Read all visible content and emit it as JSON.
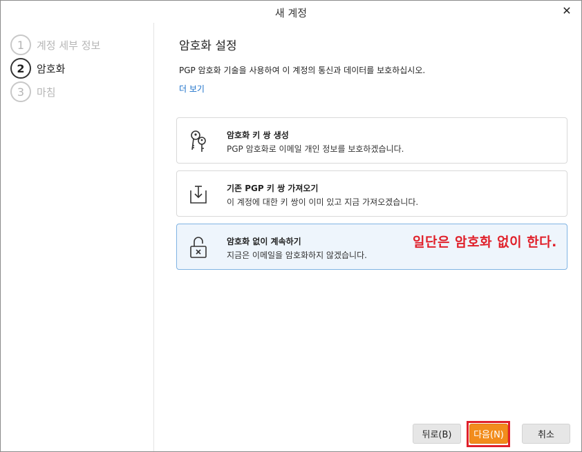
{
  "window": {
    "title": "새 계정",
    "close_icon": "close-icon"
  },
  "steps": [
    {
      "number": "1",
      "label": "계정 세부 정보"
    },
    {
      "number": "2",
      "label": "암호화"
    },
    {
      "number": "3",
      "label": "마침"
    }
  ],
  "content": {
    "heading": "암호화 설정",
    "description": "PGP 암호화 기술을 사용하여 이 계정의 통신과 데이터를 보호하십시오.",
    "more_link": "더 보기"
  },
  "options": [
    {
      "title": "암호화 키 쌍 생성",
      "description": "PGP 암호화로 이메일 개인 정보를 보호하겠습니다.",
      "icon": "keys-icon"
    },
    {
      "title": "기존 PGP 키 쌍 가져오기",
      "description": "이 계정에 대한 키 쌍이 이미 있고 지금 가져오겠습니다.",
      "icon": "import-icon"
    },
    {
      "title": "암호화 없이 계속하기",
      "description": "지금은 이메일을 암호화하지 않겠습니다.",
      "icon": "unlocked-icon"
    }
  ],
  "annotation": "일단은 암호화 없이 한다.",
  "buttons": {
    "back": "뒤로(B)",
    "next": "다음(N)",
    "cancel": "취소"
  },
  "colors": {
    "accent": "#f28c1c",
    "link": "#1a6fc9",
    "annotation": "#e0202a",
    "selected_bg": "#eef5fc"
  }
}
